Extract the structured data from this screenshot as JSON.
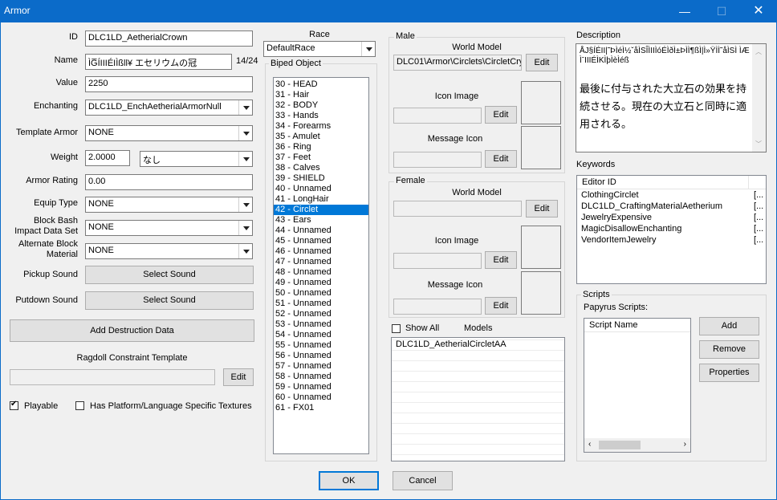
{
  "window": {
    "title": "Armor",
    "min": "—",
    "max": "☐",
    "close": "✕"
  },
  "form": {
    "id_label": "ID",
    "id_value": "DLC1LD_AetherialCrown",
    "name_label": "Name",
    "name_value": "ÌG̅ÍIIIÉIÌßll¥  エセリウムの冠",
    "name_count": "14/24",
    "value_label": "Value",
    "value_value": "2250",
    "enchanting_label": "Enchanting",
    "enchanting_value": "DLC1LD_EnchAetherialArmorNull",
    "template_label": "Template Armor",
    "template_value": "NONE",
    "weight_label": "Weight",
    "weight_value": "2.0000",
    "weight_combo": "なし",
    "armor_rating_label": "Armor Rating",
    "armor_rating_value": "0.00",
    "equip_label": "Equip Type",
    "equip_value": "NONE",
    "block_label_1": "Block Bash",
    "block_label_2": "Impact Data Set",
    "block_value": "NONE",
    "alt_label_1": "Alternate Block",
    "alt_label_2": "Material",
    "alt_value": "NONE",
    "pickup_label": "Pickup Sound",
    "pickup_button": "Select Sound",
    "putdown_label": "Putdown Sound",
    "putdown_button": "Select Sound",
    "destruction_button": "Add Destruction Data",
    "ragdoll_label": "Ragdoll Constraint Template",
    "ragdoll_edit": "Edit",
    "playable_label": "Playable",
    "platform_label": "Has Platform/Language Specific Textures"
  },
  "race": {
    "label": "Race",
    "value": "DefaultRace"
  },
  "biped": {
    "title": "Biped Object",
    "items": [
      "30 - HEAD",
      "31 - Hair",
      "32 - BODY",
      "33 - Hands",
      "34 - Forearms",
      "35 - Amulet",
      "36 - Ring",
      "37 - Feet",
      "38 - Calves",
      "39 - SHIELD",
      "40 - Unnamed",
      "41 - LongHair",
      "42 - Circlet",
      "43 - Ears",
      "44 - Unnamed",
      "45 - Unnamed",
      "46 - Unnamed",
      "47 - Unnamed",
      "48 - Unnamed",
      "49 - Unnamed",
      "50 - Unnamed",
      "51 - Unnamed",
      "52 - Unnamed",
      "53 - Unnamed",
      "54 - Unnamed",
      "55 - Unnamed",
      "56 - Unnamed",
      "57 - Unnamed",
      "58 - Unnamed",
      "59 - Unnamed",
      "60 - Unnamed",
      "61 - FX01"
    ],
    "selected": "42 - Circlet"
  },
  "male": {
    "title": "Male",
    "world_model_label": "World Model",
    "world_model_value": "DLC01\\Armor\\Circlets\\CircletCry:",
    "icon_label": "Icon Image",
    "message_label": "Message Icon",
    "edit": "Edit"
  },
  "female": {
    "title": "Female",
    "world_model_label": "World Model",
    "icon_label": "Icon Image",
    "message_label": "Message Icon",
    "edit": "Edit"
  },
  "models": {
    "show_all": "Show All",
    "label": "Models",
    "items": [
      "DLC1LD_AetherialCircletAA"
    ]
  },
  "description": {
    "label": "Description",
    "garbled": "ÅJ§ÍÉII|˜ÞÌéÌ½ˇåÌSÎÌIIÌóÉÌðÌ±ÞÌÌ¶ßÌ|Ì»ŸÌÌ˜åÌSÌ ÌÆÌˉIIIÉÌKÌþÌèÌéß",
    "text": "最後に付与された大立石の効果を持続させる。現在の大立石と同時に適用される。"
  },
  "keywords": {
    "label": "Keywords",
    "column": "Editor ID",
    "items": [
      "ClothingCirclet",
      "DLC1LD_CraftingMaterialAetherium",
      "JewelryExpensive",
      "MagicDisallowEnchanting",
      "VendorItemJewelry"
    ],
    "extra": "[..."
  },
  "scripts": {
    "title": "Scripts",
    "papyrus_label": "Papyrus Scripts:",
    "column": "Script Name",
    "add": "Add",
    "remove": "Remove",
    "properties": "Properties"
  },
  "dialog": {
    "ok": "OK",
    "cancel": "Cancel"
  }
}
